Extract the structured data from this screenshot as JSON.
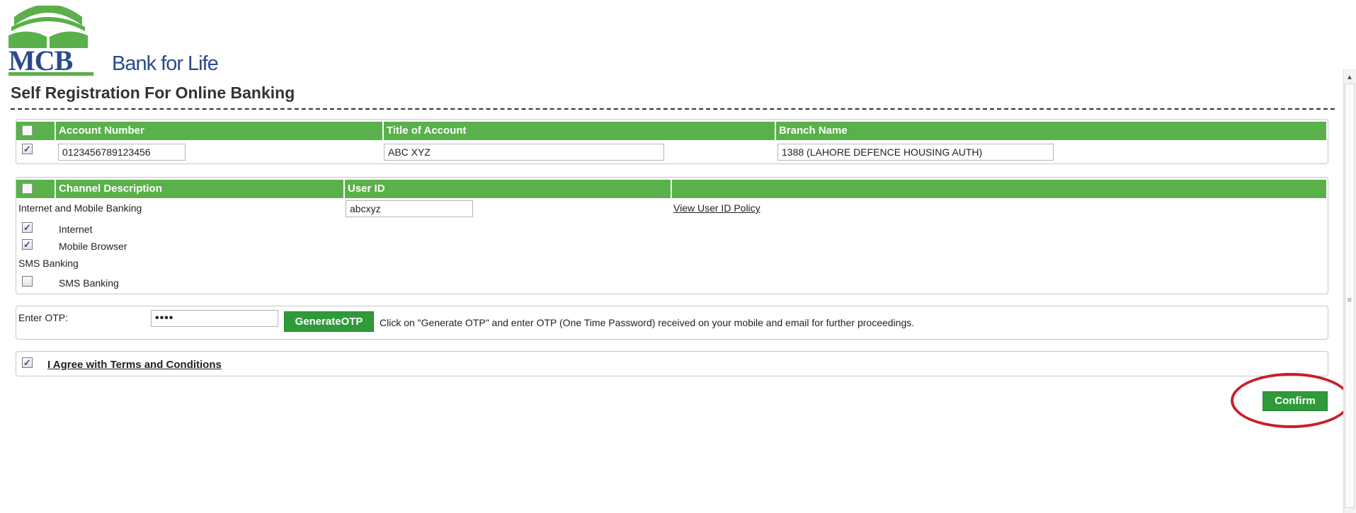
{
  "brand": {
    "logo_text": "MCB",
    "tagline": "Bank for Life",
    "colors": {
      "blue": "#2b4a8c",
      "green": "#5ab04a",
      "button_green": "#2f9a3a",
      "highlight_red": "#c8202a"
    }
  },
  "page": {
    "title": "Self Registration For Online Banking"
  },
  "accounts": {
    "headers": [
      "Account Number",
      "Title of Account",
      "Branch Name"
    ],
    "header_checked": false,
    "rows": [
      {
        "checked": true,
        "account_number": "0123456789123456",
        "title": "ABC XYZ",
        "branch": "1388 (LAHORE DEFENCE HOUSING AUTH)"
      }
    ]
  },
  "channels": {
    "headers": [
      "Channel Description",
      "User ID",
      ""
    ],
    "header_checked": false,
    "groups": [
      {
        "name": "Internet and Mobile Banking",
        "user_id": "abcxyz",
        "policy_link": "View User ID Policy",
        "items": [
          {
            "label": "Internet",
            "checked": true
          },
          {
            "label": "Mobile Browser",
            "checked": true
          }
        ]
      },
      {
        "name": "SMS Banking",
        "items": [
          {
            "label": "SMS Banking",
            "checked": false
          }
        ]
      }
    ]
  },
  "otp": {
    "label": "Enter OTP:",
    "value": "••••",
    "button": "GenerateOTP",
    "hint": "Click on \"Generate OTP\" and enter OTP (One Time Password) received on your mobile and email for further proceedings."
  },
  "terms": {
    "checked": true,
    "label": "I Agree with Terms and Conditions"
  },
  "actions": {
    "confirm": "Confirm"
  },
  "icons": {
    "checkbox_checked": "✓",
    "scroll_up": "▲",
    "scroll_grip": "≡"
  }
}
